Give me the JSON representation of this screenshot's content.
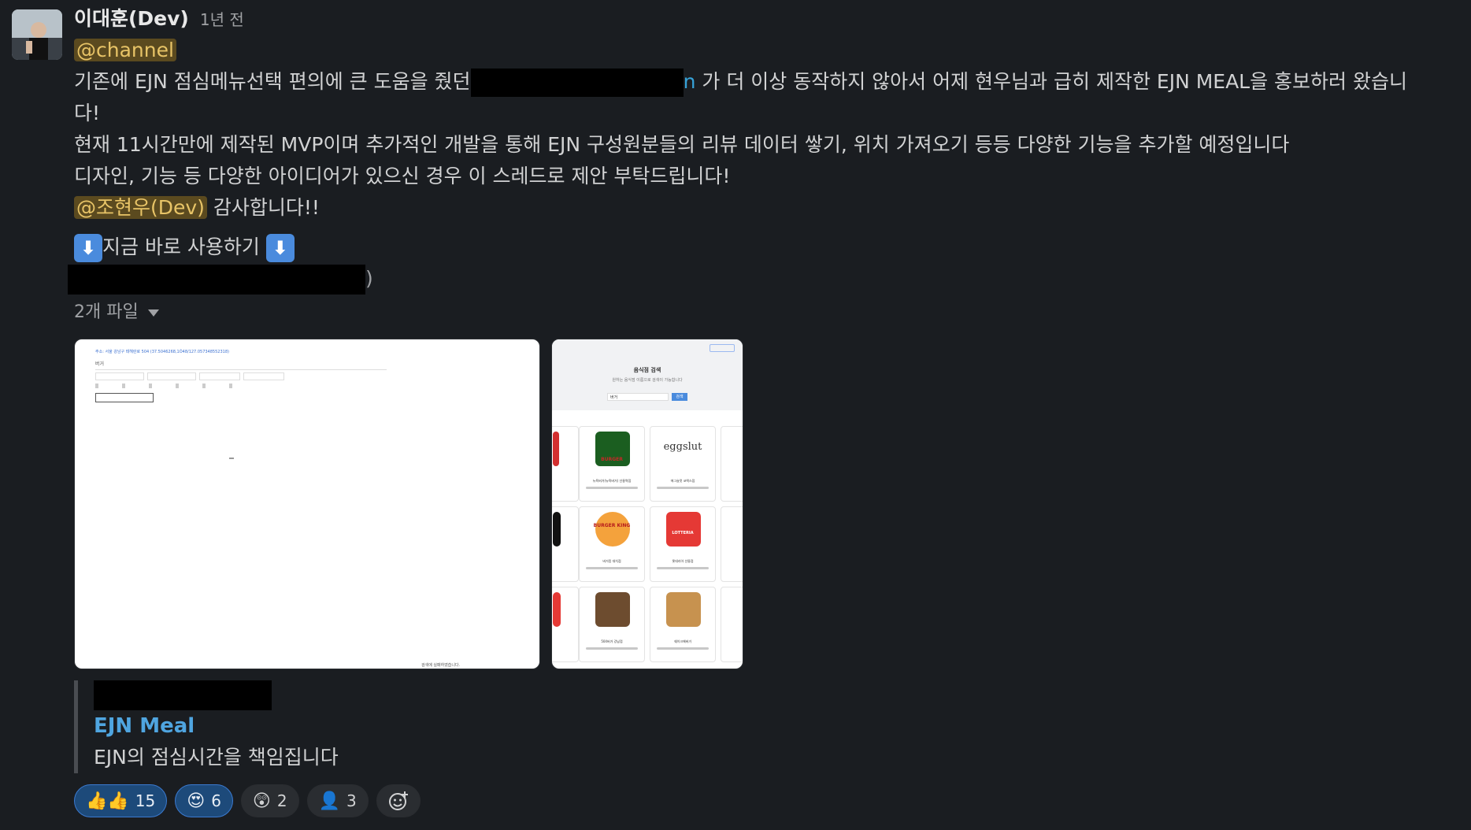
{
  "message": {
    "sender": "이대훈(Dev)",
    "time": "1년 전",
    "channel_mention": "@channel",
    "line1_before": "기존에 EJN 점심메뉴선택 편의에 큰 도움을 줬던",
    "line1_link_tail": "n",
    "line1_after": "가 더 이상 동작하지 않아서 어제 현우님과 급히 제작한 EJN MEAL을 홍보하러 왔습니",
    "line1_wrap": "다!",
    "line2": "현재 11시간만에 제작된 MVP이며 추가적인 개발을 통해 EJN 구성원분들의 리뷰 데이터 쌓기, 위치 가져오기 등등 다양한 기능을 추가할 예정입니다",
    "line3": "디자인, 기능 등 다양한 아이디어가 있으신 경우 이 스레드로 제안 부탁드립니다!",
    "user_mention": "@조현우(Dev)",
    "thanks": "감사합니다!!",
    "cta_text": "지금 바로 사용하기",
    "cta_icon": "down-arrow-emoji",
    "link_close": ")"
  },
  "files": {
    "label": "2개 파일",
    "thumb1": {
      "address_line": "주소: 서울 강남구 테헤란로 504 (37.5046268,1Ó48/127.057348552318)",
      "query": "버거",
      "footer": "검색에 실패하였습니다."
    },
    "thumb2": {
      "title": "음식점 검색",
      "subtitle": "원하는 음식점 이름으로 검색이 가능합니다",
      "search_value": "버거",
      "search_button": "검색",
      "cards": [
        {
          "brand": "BURGER",
          "name": "뉴욕버거(뉴욕버거) 선릉역점"
        },
        {
          "brand": "eggslut",
          "name": "에그슬럿 코엑스점"
        },
        {
          "brand": "BURGER KING",
          "name": "버거킹 대치점"
        },
        {
          "brand": "LOTTERIA",
          "name": "롯데리아 선릉점"
        },
        {
          "brand": "",
          "name": "504버거 강남점"
        },
        {
          "brand": "",
          "name": "쉐이크쉑버거"
        }
      ]
    }
  },
  "unfurl": {
    "title": "EJN Meal",
    "description": "EJN의 점심시간을 책임집니다"
  },
  "reactions": [
    {
      "emoji": "👍👍",
      "count": "15",
      "active": true
    },
    {
      "emoji": "😍",
      "count": "6",
      "active": true
    },
    {
      "emoji": "😲",
      "count": "2",
      "active": false
    },
    {
      "emoji": "👤",
      "count": "3",
      "active": false
    }
  ],
  "colors": {
    "background": "#1a1d21",
    "mention_bg": "#5b4a1f",
    "mention_text": "#e8c467",
    "link": "#36a3d9",
    "active_reaction": "#1d4a7a"
  }
}
